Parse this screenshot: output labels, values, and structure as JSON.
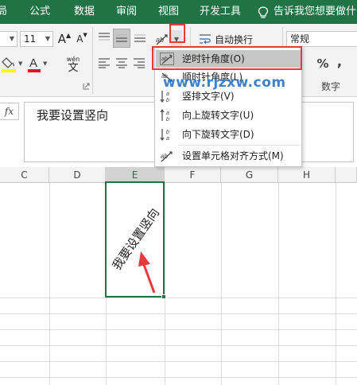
{
  "menubar": {
    "tabs": [
      "局",
      "公式",
      "数据",
      "审阅",
      "视图",
      "开发工具"
    ],
    "tell_me": "告诉我您想要做什么"
  },
  "ribbon": {
    "font_size": "11",
    "grow_font": "A",
    "shrink_font": "A",
    "wen_label": "wén",
    "wrap_text": "自动换行",
    "number_format": "常规",
    "number_group_label": "数字",
    "percent": "%",
    "comma": ","
  },
  "formula_bar": {
    "fx": "fx",
    "value": "我要设置竖向"
  },
  "columns": [
    "C",
    "D",
    "E",
    "F",
    "G",
    "H"
  ],
  "active_column": "E",
  "cell": {
    "text": "我要设置竖向"
  },
  "orientation_menu": {
    "items": [
      {
        "label": "逆时针角度(O)",
        "icon": "angle-counterclockwise-icon"
      },
      {
        "label": "顺时针角度(L)",
        "icon": "angle-clockwise-icon"
      },
      {
        "label": "竖排文字(V)",
        "icon": "vertical-text-icon"
      },
      {
        "label": "向上旋转文字(U)",
        "icon": "rotate-text-up-icon"
      },
      {
        "label": "向下旋转文字(D)",
        "icon": "rotate-text-down-icon"
      },
      {
        "label": "设置单元格对齐方式(M)",
        "icon": "format-cell-alignment-icon"
      }
    ]
  },
  "watermark": "www.rjzxw.com",
  "colors": {
    "excel_green": "#217346",
    "highlight_red": "#e8393c",
    "watermark_blue": "#2f77c8"
  }
}
